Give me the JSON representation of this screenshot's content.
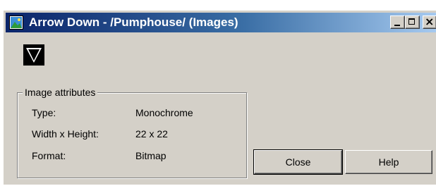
{
  "window": {
    "title": "Arrow Down - /Pumphouse/ (Images)"
  },
  "titlebar_buttons": {
    "minimize_icon": "minimize-icon",
    "maximize_icon": "maximize-icon",
    "close_glyph": "×"
  },
  "preview": {
    "icon": "arrow-down-icon"
  },
  "attributes": {
    "group_title": "Image attributes",
    "rows": [
      {
        "label": "Type:",
        "value": "Monochrome"
      },
      {
        "label": "Width x Height:",
        "value": "22 x 22"
      },
      {
        "label": "Format:",
        "value": "Bitmap"
      }
    ]
  },
  "buttons": {
    "close_label": "Close",
    "help_label": "Help"
  },
  "colors": {
    "face": "#d4d0c8",
    "title_gradient_start": "#0a246a",
    "title_gradient_end": "#a6caf0"
  }
}
